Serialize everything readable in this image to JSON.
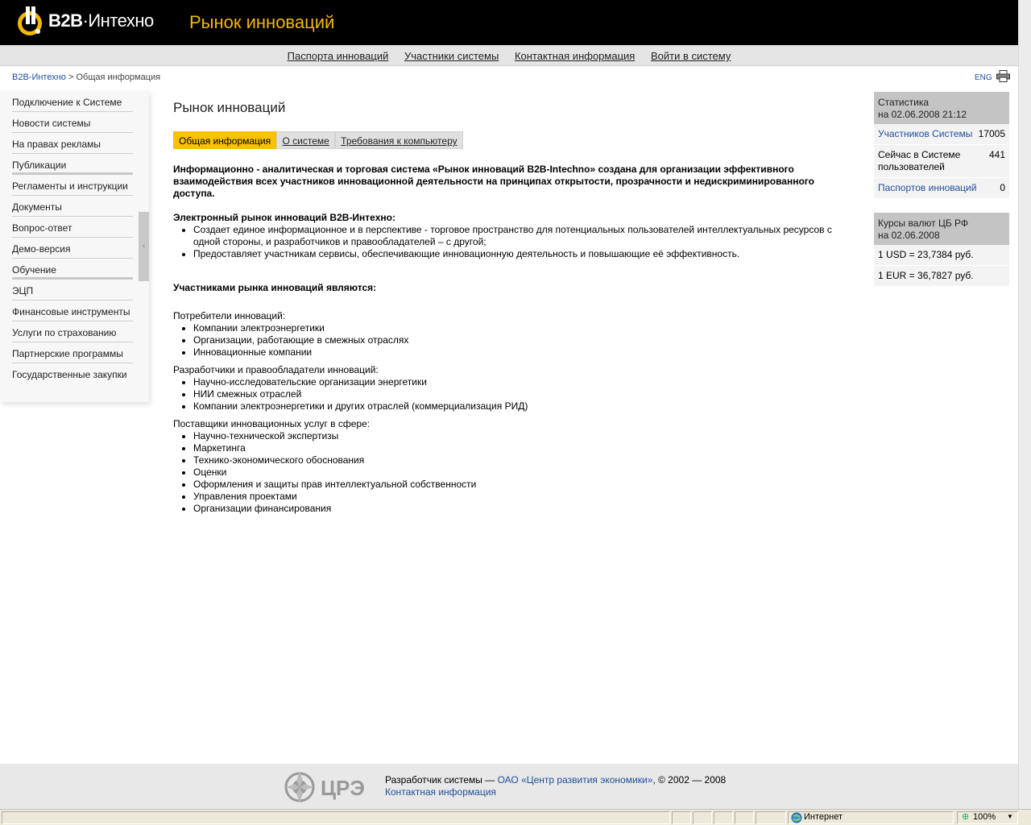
{
  "header": {
    "logo_bold": "B2B",
    "logo_rest": "·Интехно",
    "site_title": "Рынок инноваций"
  },
  "topnav": [
    "Паспорта инноваций",
    "Участники системы",
    "Контактная информация",
    "Войти в систему"
  ],
  "breadcrumb": {
    "home": "B2B-Интехно",
    "current": "> Общая информация"
  },
  "lang": "ENG",
  "sidebar": [
    "Подключение к Системе",
    "Новости системы",
    "На правах рекламы",
    "Публикации",
    "Регламенты и инструкции",
    "Документы",
    "Вопрос-ответ",
    "Демо-версия",
    "Обучение",
    "ЭЦП",
    "Финансовые инструменты",
    "Услуги по страхованию",
    "Партнерские программы",
    "Государственные закупки"
  ],
  "main": {
    "title": "Рынок инноваций",
    "tabs": [
      "Общая информация",
      "О системе",
      "Требования к компьютеру"
    ],
    "intro": "Информационно - аналитическая и торговая система «Рынок инноваций B2B-Intechno» создана для организации эффективного взаимодействия всех участников инновационной деятельности на принципах открытости, прозрачности и недискриминированного доступа.",
    "market_title": "Электронный рынок инноваций B2B-Интехно:",
    "market_items": [
      "Создает единое информационное и в перспективе - торговое пространство для потенциальных пользователей интеллектуальных ресурсов с одной стороны, и разработчиков и правообладателей – с другой;",
      "Предоставляет участникам сервисы, обеспечивающие инновационную деятельность и повышающие её эффективность."
    ],
    "participants_title": "Участниками рынка инноваций являются:",
    "consumers_title": "Потребители инноваций:",
    "consumers": [
      "Компании электроэнергетики",
      "Организации, работающие в смежных отраслях",
      "Инновационные компании"
    ],
    "developers_title": "Разработчики и правообладатели инноваций:",
    "developers": [
      "Научно-исследовательские организации энергетики",
      "НИИ смежных отраслей",
      "Компании электроэнергетики и других отраслей (коммерциализация РИД)"
    ],
    "providers_title": "Поставщики инновационных услуг в сфере:",
    "providers": [
      "Научно-технической экспертизы",
      "Маркетинга",
      "Технико-экономического обоснования",
      "Оценки",
      "Оформления и защиты прав интеллектуальной собственности",
      "Управления проектами",
      "Организации финансирования"
    ]
  },
  "stats": {
    "head1": "Статистика",
    "head2": "на 02.06.2008 21:12",
    "participants_label": "Участников Системы",
    "participants_value": "17005",
    "online_label": "Сейчас в Системе пользователей",
    "online_value": "441",
    "passports_label": "Паспортов инноваций",
    "passports_value": "0"
  },
  "rates": {
    "head1": "Курсы валют ЦБ РФ",
    "head2": "на 02.06.2008",
    "usd": "1 USD = 23,7384 руб.",
    "eur": "1 EUR = 36,7827 руб."
  },
  "footer": {
    "logo_text": "ЦРЭ",
    "dev_prefix": "Разработчик системы — ",
    "dev_link": "ОАО «Центр развития экономики»",
    "dev_suffix": ", © 2002 — 2008",
    "contact": "Контактная информация"
  },
  "statusbar": {
    "zone": "Интернет",
    "zoom": "100%"
  },
  "colors": {
    "accent": "#f8c200",
    "link": "#1f4f9a",
    "header_bg": "#000000"
  }
}
